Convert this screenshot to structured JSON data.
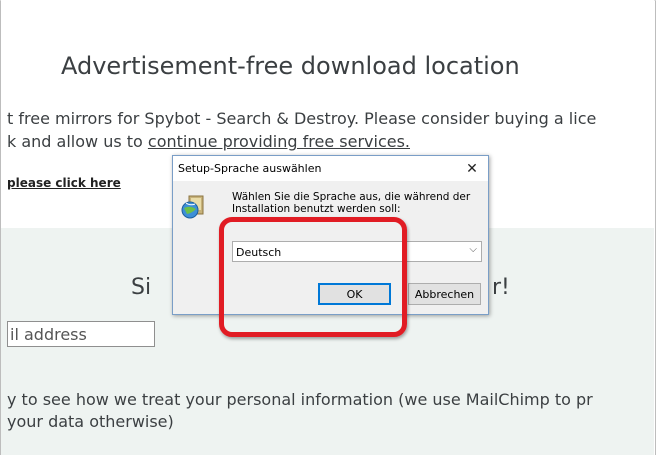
{
  "page": {
    "heading": "Advertisement-free download location",
    "line1": "t free mirrors for Spybot - Search & Destroy. Please consider buying a lice",
    "line2_pre": "k and allow us to ",
    "line2_link": "continue providing free services.",
    "click_here": "please click here",
    "signup_left": "Si",
    "signup_right": "r!",
    "email_placeholder": "il address",
    "privacy_line1": "y to see how we treat your personal information (we use MailChimp to pr",
    "privacy_line2": "your data otherwise)"
  },
  "dialog": {
    "title": "Setup-Sprache auswählen",
    "prompt": "Wählen Sie die Sprache aus, die während der Installation benutzt werden soll:",
    "selected_language": "Deutsch",
    "ok_label": "OK",
    "cancel_label": "Abbrechen",
    "close_glyph": "✕",
    "chevron_glyph": "⌵",
    "icon": "setup-globe-icon"
  },
  "colors": {
    "highlight": "#e11c24",
    "newsletter_bg": "#eef3f1",
    "focus_border": "#0078d7"
  }
}
